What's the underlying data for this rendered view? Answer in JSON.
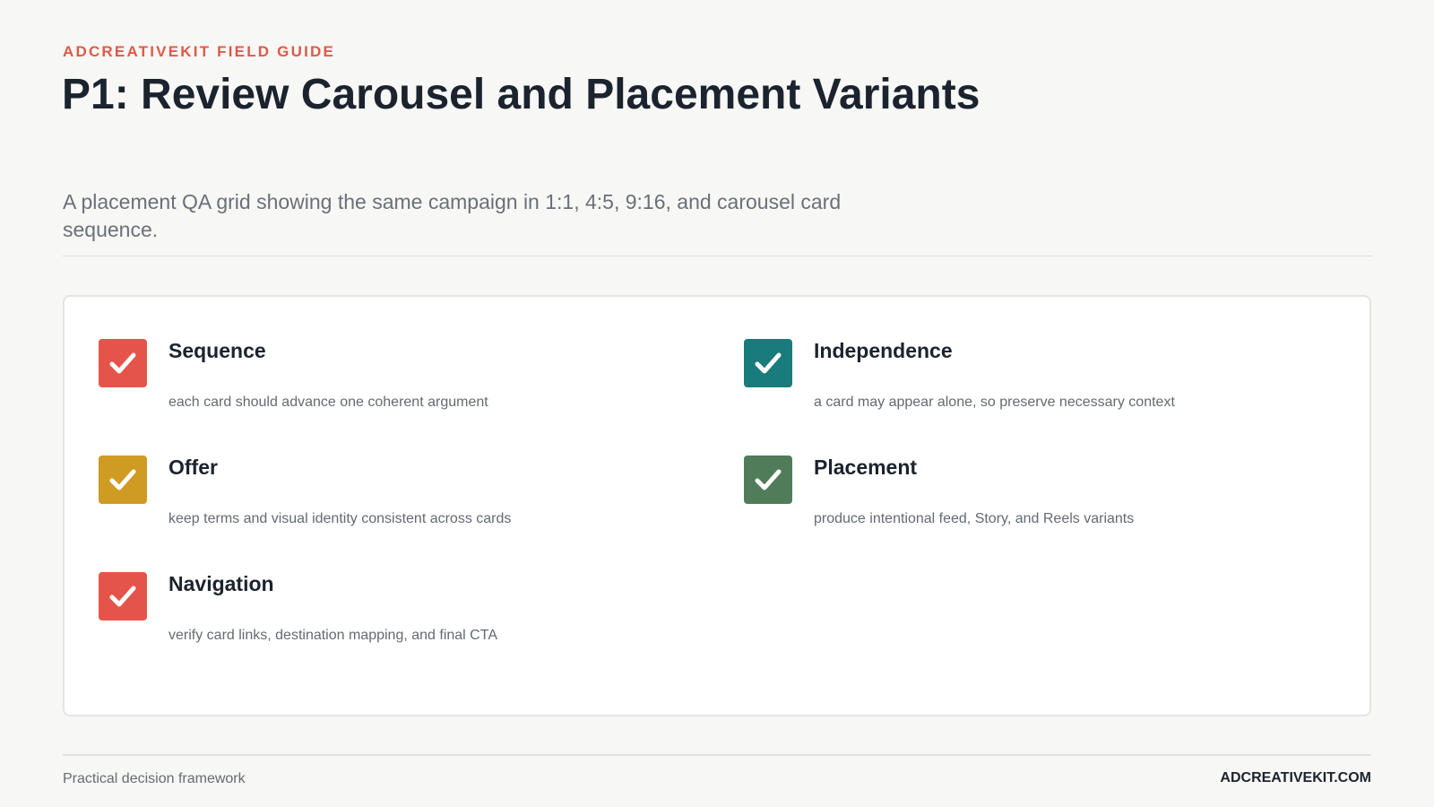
{
  "header": {
    "eyebrow": "ADCREATIVEKIT FIELD GUIDE",
    "title": "P1: Review Carousel and Placement Variants",
    "subtitle": "A placement QA grid showing the same campaign in 1:1, 4:5, 9:16, and carousel card sequence."
  },
  "checklist": {
    "items": [
      {
        "title": "Sequence",
        "description": "each card should advance one coherent argument",
        "icon": "check-icon",
        "color": "#e5544a"
      },
      {
        "title": "Independence",
        "description": "a card may appear alone, so preserve necessary context",
        "icon": "check-icon",
        "color": "#1a7b7d"
      },
      {
        "title": "Offer",
        "description": "keep terms and visual identity consistent across cards",
        "icon": "check-icon",
        "color": "#cf9b22"
      },
      {
        "title": "Placement",
        "description": "produce intentional feed, Story, and Reels variants",
        "icon": "check-icon",
        "color": "#517c5a"
      },
      {
        "title": "Navigation",
        "description": "verify card links, destination mapping, and final CTA",
        "icon": "check-icon",
        "color": "#e5544a"
      }
    ]
  },
  "footer": {
    "left": "Practical decision framework",
    "right": "ADCREATIVEKIT.COM"
  }
}
